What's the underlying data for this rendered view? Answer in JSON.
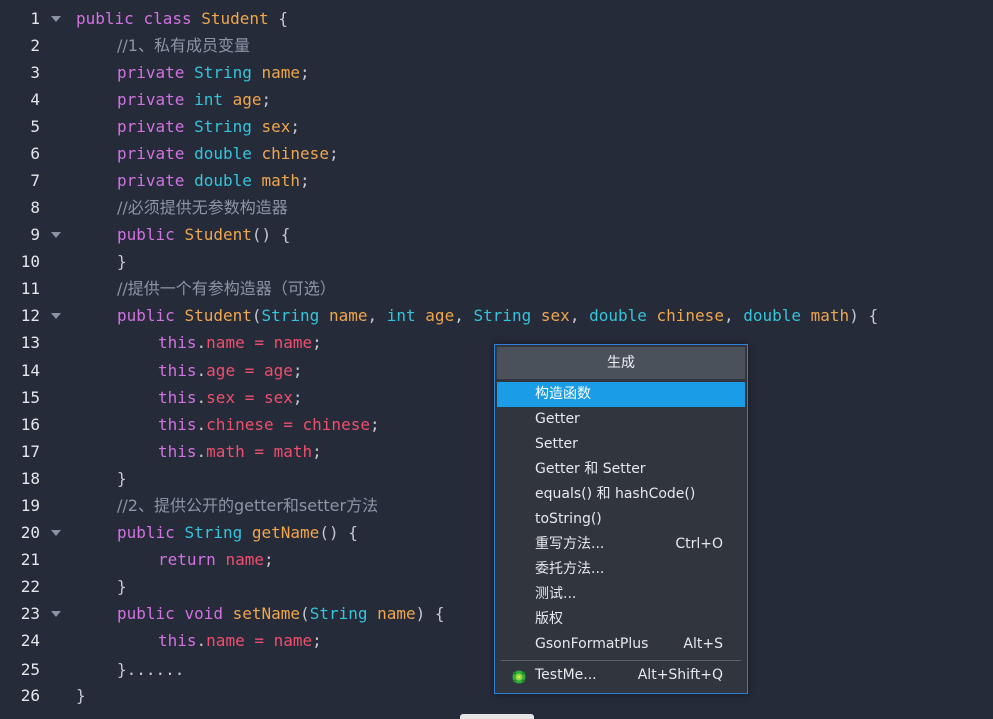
{
  "code": {
    "line_numbers": [
      "1",
      "2",
      "3",
      "4",
      "5",
      "6",
      "7",
      "8",
      "9",
      "10",
      "11",
      "12",
      "13",
      "14",
      "15",
      "16",
      "17",
      "18",
      "19",
      "20",
      "21",
      "22",
      "23",
      "24",
      "25",
      "26"
    ],
    "tokens": {
      "public": "public",
      "class": "class",
      "private": "private",
      "void": "void",
      "return": "return",
      "this": "this",
      "String": "String",
      "int": "int",
      "double": "double",
      "Student": "Student",
      "getName": "getName",
      "setName": "setName",
      "name": "name",
      "age": "age",
      "sex": "sex",
      "chinese": "chinese",
      "math": "math",
      "ellipsis": "}......"
    },
    "comments": {
      "c1": "//1、私有成员变量",
      "c2": "//必须提供无参数构造器",
      "c3": "//提供一个有参构造器（可选）",
      "c4": "//2、提供公开的getter和setter方法"
    }
  },
  "menu": {
    "title": "生成",
    "items": [
      {
        "label": "构造函数",
        "shortcut": ""
      },
      {
        "label": "Getter",
        "shortcut": ""
      },
      {
        "label": "Setter",
        "shortcut": ""
      },
      {
        "label": "Getter 和 Setter",
        "shortcut": ""
      },
      {
        "label": "equals() 和 hashCode()",
        "shortcut": ""
      },
      {
        "label": "toString()",
        "shortcut": ""
      },
      {
        "label": "重写方法...",
        "shortcut": "Ctrl+O"
      },
      {
        "label": "委托方法...",
        "shortcut": ""
      },
      {
        "label": "测试...",
        "shortcut": ""
      },
      {
        "label": "版权",
        "shortcut": ""
      },
      {
        "label": "GsonFormatPlus",
        "shortcut": "Alt+S"
      }
    ],
    "footer_item": {
      "label": "TestMe...",
      "shortcut": "Alt+Shift+Q",
      "icon": "testme-plugin-icon"
    }
  },
  "colors": {
    "background": "#252b39",
    "keyword": "#d272e0",
    "type": "#36c4da",
    "identifier": "#f0a64e",
    "this_ref": "#ef4f6e",
    "comment": "#8c95a6",
    "menu_selected": "#1a9de6"
  }
}
